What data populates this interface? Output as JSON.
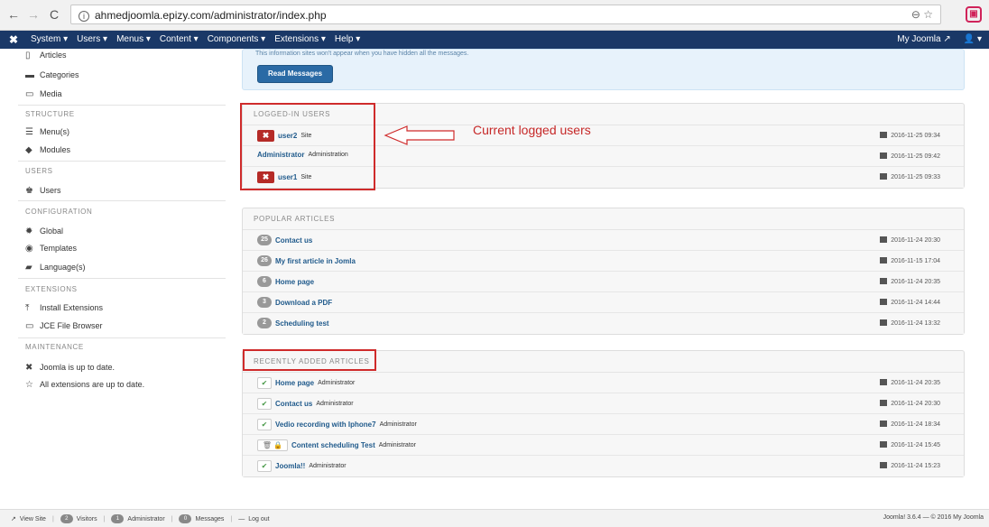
{
  "browser": {
    "back": "←",
    "forward": "→",
    "reload": "C",
    "url": "ahmedjoomla.epizy.com/administrator/index.php",
    "zoom_icon": "⊖",
    "star_icon": "☆",
    "ext_icon": "▣"
  },
  "topnav": {
    "brand": "✖",
    "menu": [
      "System ▾",
      "Users ▾",
      "Menus ▾",
      "Content ▾",
      "Components ▾",
      "Extensions ▾",
      "Help ▾"
    ],
    "site_link": "My Joomla ↗",
    "user_menu": "👤 ▾"
  },
  "sidebar": {
    "articles": "Articles",
    "categories": "Categories",
    "media": "Media",
    "structure_heading": "STRUCTURE",
    "menus": "Menu(s)",
    "modules": "Modules",
    "users_heading": "USERS",
    "users": "Users",
    "configuration_heading": "CONFIGURATION",
    "global": "Global",
    "templates": "Templates",
    "languages": "Language(s)",
    "extensions_heading": "EXTENSIONS",
    "install_extensions": "Install Extensions",
    "jce_file_browser": "JCE File Browser",
    "maintenance_heading": "MAINTENANCE",
    "joomla_up_to_date": "Joomla is up to date.",
    "extensions_up_to_date": "All extensions are up to date."
  },
  "alert": {
    "message": "This information sites won't appear when you have hidden all the messages.",
    "button": "Read Messages"
  },
  "logged_in_users": {
    "heading": "LOGGED-IN USERS",
    "rows": [
      {
        "name": "user2",
        "location": "Site",
        "date": "2016-11-25 09:34",
        "logout": "✖"
      },
      {
        "name": "Administrator",
        "location": "Administration",
        "date": "2016-11-25 09:42",
        "logout": ""
      },
      {
        "name": "user1",
        "location": "Site",
        "date": "2016-11-25 09:33",
        "logout": "✖"
      }
    ]
  },
  "popular_articles": {
    "heading": "POPULAR ARTICLES",
    "rows": [
      {
        "hits": "25",
        "title": "Contact us",
        "date": "2016-11-24 20:30"
      },
      {
        "hits": "26",
        "title": "My first article in Jomla",
        "date": "2016-11-15 17:04"
      },
      {
        "hits": "6",
        "title": "Home page",
        "date": "2016-11-24 20:35"
      },
      {
        "hits": "3",
        "title": "Download a PDF",
        "date": "2016-11-24 14:44"
      },
      {
        "hits": "2",
        "title": "Scheduling test",
        "date": "2016-11-24 13:32"
      }
    ]
  },
  "recent_articles": {
    "heading": "RECENTLY ADDED ARTICLES",
    "rows": [
      {
        "state": "✔",
        "title": "Home page",
        "author": "Administrator",
        "date": "2016-11-24 20:35"
      },
      {
        "state": "✔",
        "title": "Contact us",
        "author": "Administrator",
        "date": "2016-11-24 20:30"
      },
      {
        "state": "✔",
        "title": "Vedio recording with Iphone7",
        "author": "Administrator",
        "date": "2016-11-24 18:34"
      },
      {
        "state": "🗑 🔒",
        "title": "Content scheduling Test",
        "author": "Administrator",
        "date": "2016-11-24 15:45"
      },
      {
        "state": "✔",
        "title": "Joomla!!",
        "author": "Administrator",
        "date": "2016-11-24 15:23"
      }
    ]
  },
  "annotation": {
    "text": "Current logged users",
    "accent": "#cf2b2b"
  },
  "statusbar": {
    "view_site": "View Site",
    "visitors_count": "2",
    "visitors": "Visitors",
    "admin_count": "1",
    "administrator": "Administrator",
    "messages_count": "0",
    "messages": "Messages",
    "logout": "Log out",
    "version": "Joomla! 3.6.4 — © 2016 My Joomla"
  }
}
